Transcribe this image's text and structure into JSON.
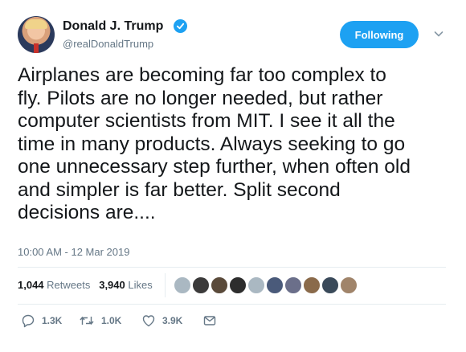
{
  "user": {
    "display_name": "Donald J. Trump",
    "handle": "@realDonaldTrump",
    "verified": true
  },
  "follow_button": {
    "label": "Following"
  },
  "tweet": {
    "lines": [
      "Airplanes are becoming far too complex to",
      "fly. Pilots are no longer needed, but rather",
      "computer scientists from MIT. I see it all the",
      "time in many products. Always seeking to go",
      "one unnecessary step further, when often old",
      "and simpler is far better. Split second",
      "decisions are...."
    ],
    "timestamp": "10:00 AM - 12 Mar 2019"
  },
  "stats": {
    "retweets_count": "1,044",
    "retweets_label": "Retweets",
    "likes_count": "3,940",
    "likes_label": "Likes"
  },
  "likers": [
    {
      "icon": "avatar-default",
      "color": "#aab8c2"
    },
    {
      "icon": "avatar-photo",
      "color": "#3b3a3a"
    },
    {
      "icon": "avatar-photo",
      "color": "#5a4a3a"
    },
    {
      "icon": "avatar-photo",
      "color": "#2d2d2d"
    },
    {
      "icon": "avatar-default",
      "color": "#aab8c2"
    },
    {
      "icon": "avatar-photo",
      "color": "#4a5a7a"
    },
    {
      "icon": "avatar-flag",
      "color": "#6b6f8a"
    },
    {
      "icon": "avatar-photo",
      "color": "#8a6a4a"
    },
    {
      "icon": "avatar-photo",
      "color": "#3a4a5a"
    },
    {
      "icon": "avatar-photo",
      "color": "#a0846a"
    }
  ],
  "actions": {
    "reply_count": "1.3K",
    "retweet_count": "1.0K",
    "like_count": "3.9K"
  },
  "colors": {
    "accent": "#1da1f2",
    "secondary_text": "#657786",
    "divider": "#e6ecf0"
  }
}
